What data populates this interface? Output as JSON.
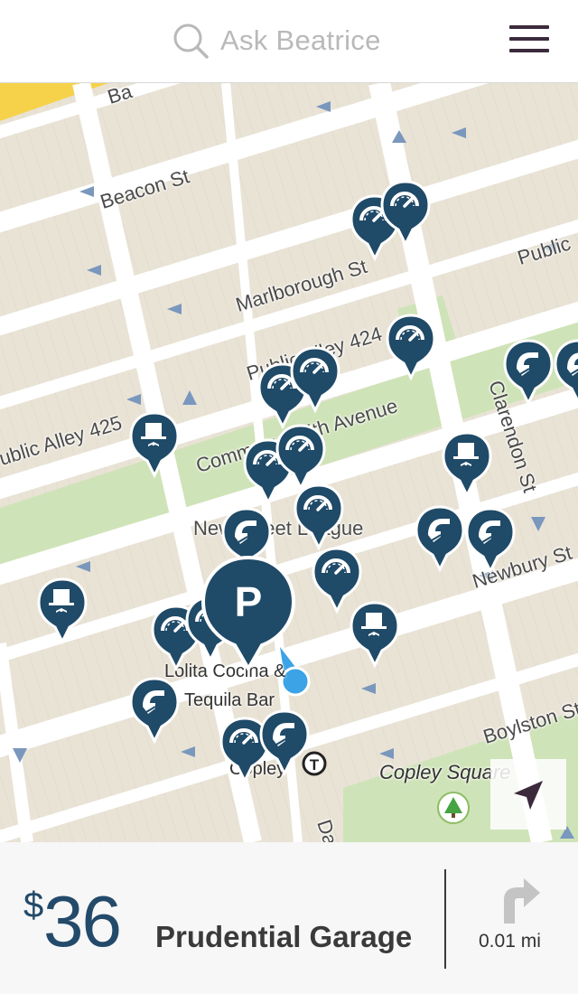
{
  "header": {
    "search_placeholder": "Ask Beatrice",
    "search_icon": "search-icon",
    "menu_icon": "hamburger-menu-icon"
  },
  "map": {
    "street_labels": {
      "beacon": "Beacon St",
      "marlborough": "Marlborough St",
      "public_alley_424": "Public Alley 424",
      "public_alley_425": "ublic Alley 425",
      "commonwealth": "Commonwealth Avenue",
      "clarendon": "Clarendon St",
      "newbury": "Newbury St",
      "boylston": "Boylston St",
      "public": "Public",
      "ba": "Ba",
      "da": "Da",
      "newbury_league": "New            Street League"
    },
    "poi_labels": {
      "lolita": "Lolita Cocina &",
      "tequila": "Tequila Bar",
      "copley": "Copley",
      "copley_square": "Copley Square"
    },
    "selected_pin_letter": "P",
    "transit_letter": "T",
    "locate_icon": "navigation-arrow-icon",
    "colors": {
      "pin": "#1f4a68",
      "road": "#ffffff",
      "block": "#e9e3d6",
      "park": "#cfe3b8",
      "user_location": "#3ba3e6"
    }
  },
  "footer": {
    "currency": "$",
    "price": "36",
    "garage_name": "Prudential Garage",
    "distance": "0.01 mi",
    "direction_icon": "turn-right-arrow-icon"
  }
}
